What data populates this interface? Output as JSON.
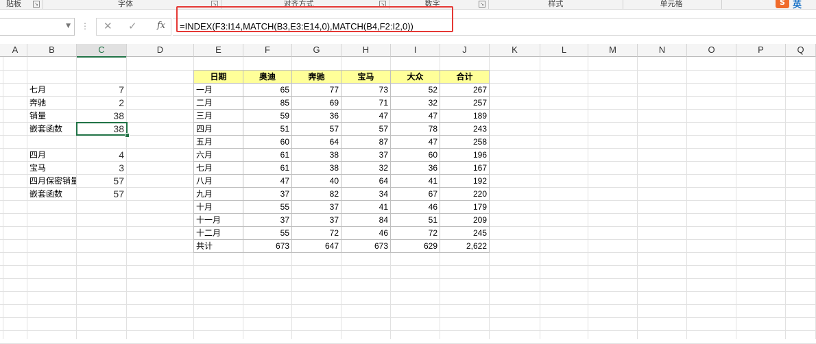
{
  "ribbon": {
    "groups": [
      {
        "label": "贴板"
      },
      {
        "label": "字体"
      },
      {
        "label": "对齐方式"
      },
      {
        "label": "数字"
      },
      {
        "label": "样式"
      },
      {
        "label": "单元格"
      }
    ],
    "ime_badge": "S",
    "ime_label": "英"
  },
  "formula_bar": {
    "name_box": "",
    "cancel_icon": "close-icon",
    "enter_icon": "check-icon",
    "fx_label": "fx",
    "formula": "=INDEX(F3:I14,MATCH(B3,E3:E14,0),MATCH(B4,F2:I2,0))",
    "highlight_color": "#e53935"
  },
  "columns": [
    "A",
    "B",
    "C",
    "D",
    "E",
    "F",
    "G",
    "H",
    "I",
    "J",
    "K",
    "L",
    "M",
    "N",
    "O",
    "P",
    "Q"
  ],
  "selected_column": "C",
  "left_block": [
    {
      "label": "七月",
      "value": "7"
    },
    {
      "label": "奔驰",
      "value": "2"
    },
    {
      "label": "销量",
      "value": "38"
    },
    {
      "label": "嵌套函数",
      "value": "38"
    },
    {
      "label": "",
      "value": ""
    },
    {
      "label": "四月",
      "value": "4"
    },
    {
      "label": "宝马",
      "value": "3"
    },
    {
      "label": "四月保密销量",
      "value": "57"
    },
    {
      "label": "嵌套函数",
      "value": "57"
    }
  ],
  "table": {
    "headers": [
      "日期",
      "奥迪",
      "奔驰",
      "宝马",
      "大众",
      "合计"
    ],
    "header_fill": "#ffff99",
    "rows": [
      [
        "一月",
        "65",
        "77",
        "73",
        "52",
        "267"
      ],
      [
        "二月",
        "85",
        "69",
        "71",
        "32",
        "257"
      ],
      [
        "三月",
        "59",
        "36",
        "47",
        "47",
        "189"
      ],
      [
        "四月",
        "51",
        "57",
        "57",
        "78",
        "243"
      ],
      [
        "五月",
        "60",
        "64",
        "87",
        "47",
        "258"
      ],
      [
        "六月",
        "61",
        "38",
        "37",
        "60",
        "196"
      ],
      [
        "七月",
        "61",
        "38",
        "32",
        "36",
        "167"
      ],
      [
        "八月",
        "47",
        "40",
        "64",
        "41",
        "192"
      ],
      [
        "九月",
        "37",
        "82",
        "34",
        "67",
        "220"
      ],
      [
        "十月",
        "55",
        "37",
        "41",
        "46",
        "179"
      ],
      [
        "十一月",
        "37",
        "37",
        "84",
        "51",
        "209"
      ],
      [
        "十二月",
        "55",
        "72",
        "46",
        "72",
        "245"
      ],
      [
        "共计",
        "673",
        "647",
        "673",
        "629",
        "2,622"
      ]
    ]
  },
  "accent_color": "#217346"
}
